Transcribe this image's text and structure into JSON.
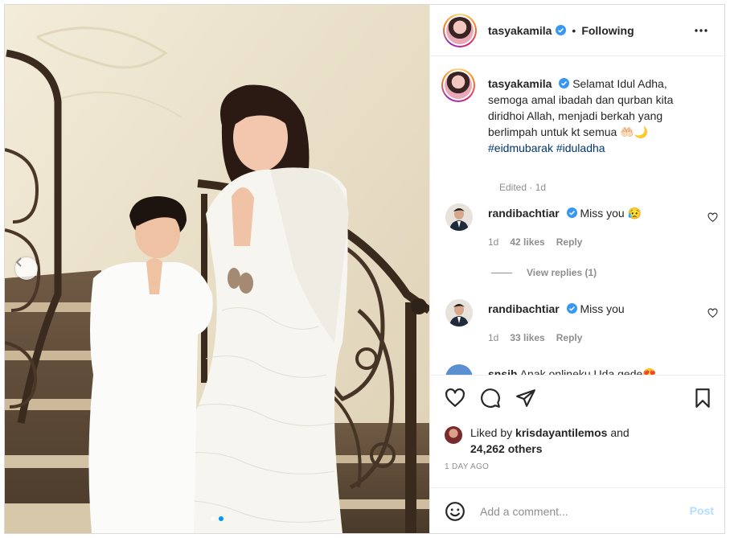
{
  "post": {
    "username": "tasyakamila",
    "follow_state": "Following",
    "bullet": "•"
  },
  "caption": {
    "username": "tasyakamila",
    "text": "Selamat Idul Adha, semoga amal ibadah dan qurban kita diridhoi Allah, menjadi berkah yang berlimpah untuk kt semua 🤲🏻🌙",
    "hashtags": [
      "#eidmubarak",
      "#iduladha"
    ],
    "edited": "Edited · 1d"
  },
  "comments": [
    {
      "username": "randibachtiar",
      "text": "Miss you 😥",
      "age": "1d",
      "likes": "42 likes",
      "reply": "Reply"
    },
    {
      "username": "randibachtiar",
      "text": "Miss you",
      "age": "1d",
      "likes": "33 likes",
      "reply": "Reply"
    },
    {
      "username": "snsjh",
      "text": "Anak onlineku Uda gede😍",
      "age": "",
      "likes": "",
      "reply": ""
    }
  ],
  "view_replies": "View replies (1)",
  "likes": {
    "prefix": "Liked by",
    "liker": "krisdayantilemos",
    "joiner": "and",
    "others": "24,262 others"
  },
  "timestamp": "1 DAY AGO",
  "add_comment": {
    "placeholder": "Add a comment...",
    "post_label": "Post"
  },
  "icons": {
    "verified": "verified-badge-icon",
    "more": "more-options-icon",
    "like": "heart-icon",
    "comment": "comment-bubble-icon",
    "share": "paper-plane-icon",
    "save": "bookmark-icon",
    "emoji": "smiley-icon",
    "carousel_prev": "chevron-left-icon"
  },
  "colors": {
    "verified_blue": "#3897f0",
    "hashtag": "#00376b",
    "post_disabled": "#b2dffc",
    "active_dot": "#0095f6"
  },
  "carousel": {
    "slides": 2,
    "active": 1
  }
}
